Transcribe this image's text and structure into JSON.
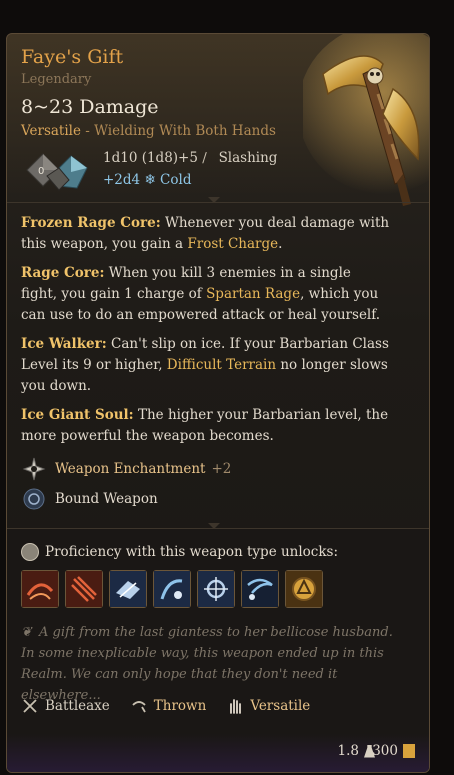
{
  "item": {
    "name": "Faye's Gift",
    "rarity": "Legendary",
    "damage_range": "8~23 Damage",
    "versatile_label": "Versatile",
    "versatile_detail": "- Wielding With Both Hands",
    "damage_main": "1d10 (1d8)+5",
    "damage_main_type": "Slashing",
    "damage_extra": "+2d4",
    "damage_extra_type": "Cold"
  },
  "passives": [
    {
      "title": "Frozen Rage Core:",
      "text1": "Whenever you deal damage with this weapon, you gain a ",
      "highlight": "Frost Charge",
      "text2": "."
    },
    {
      "title": "Rage Core:",
      "text1": "When you kill 3 enemies in a single fight, you gain 1 charge of ",
      "highlight": "Spartan Rage",
      "text2": ", which you can use to do an empowered attack or heal yourself."
    },
    {
      "title": "Ice Walker:",
      "text1": "Can't slip on ice. If your Barbarian Class Level its 9 or higher, ",
      "highlight": "Difficult Terrain",
      "text2": " no longer slows you down."
    },
    {
      "title": "Ice Giant Soul:",
      "text1": "The higher your Barbarian level, the more powerful the weapon becomes.",
      "highlight": "",
      "text2": ""
    }
  ],
  "enchantment": {
    "label": "Weapon Enchantment",
    "value": "+2"
  },
  "bound": {
    "label": "Bound Weapon"
  },
  "proficiency": {
    "header": "Proficiency with this weapon type unlocks:",
    "skills": [
      "cleave-skill-icon",
      "lacerate-skill-icon",
      "rush-attack-skill-icon",
      "topple-skill-icon",
      "pommel-strike-skill-icon",
      "sweep-skill-icon",
      "prepare-skill-icon"
    ]
  },
  "flavor": "A gift from the last giantess to her bellicose husband. In some inexplicable way, this weapon ended up in this Realm. We can only hope that they don't need it elsewhere...",
  "properties": [
    {
      "label": "Battleaxe",
      "color": "#d8d0c2",
      "icon": "battleaxe-icon"
    },
    {
      "label": "Thrown",
      "color": "#e8c38a",
      "icon": "thrown-icon"
    },
    {
      "label": "Versatile",
      "color": "#e8c38a",
      "icon": "versatile-hand-icon"
    }
  ],
  "footer": {
    "weight": "1.8",
    "value": "300"
  },
  "colors": {
    "accent": "#e3a24a",
    "cold": "#8ec6e6",
    "highlight": "#e8b85a"
  }
}
